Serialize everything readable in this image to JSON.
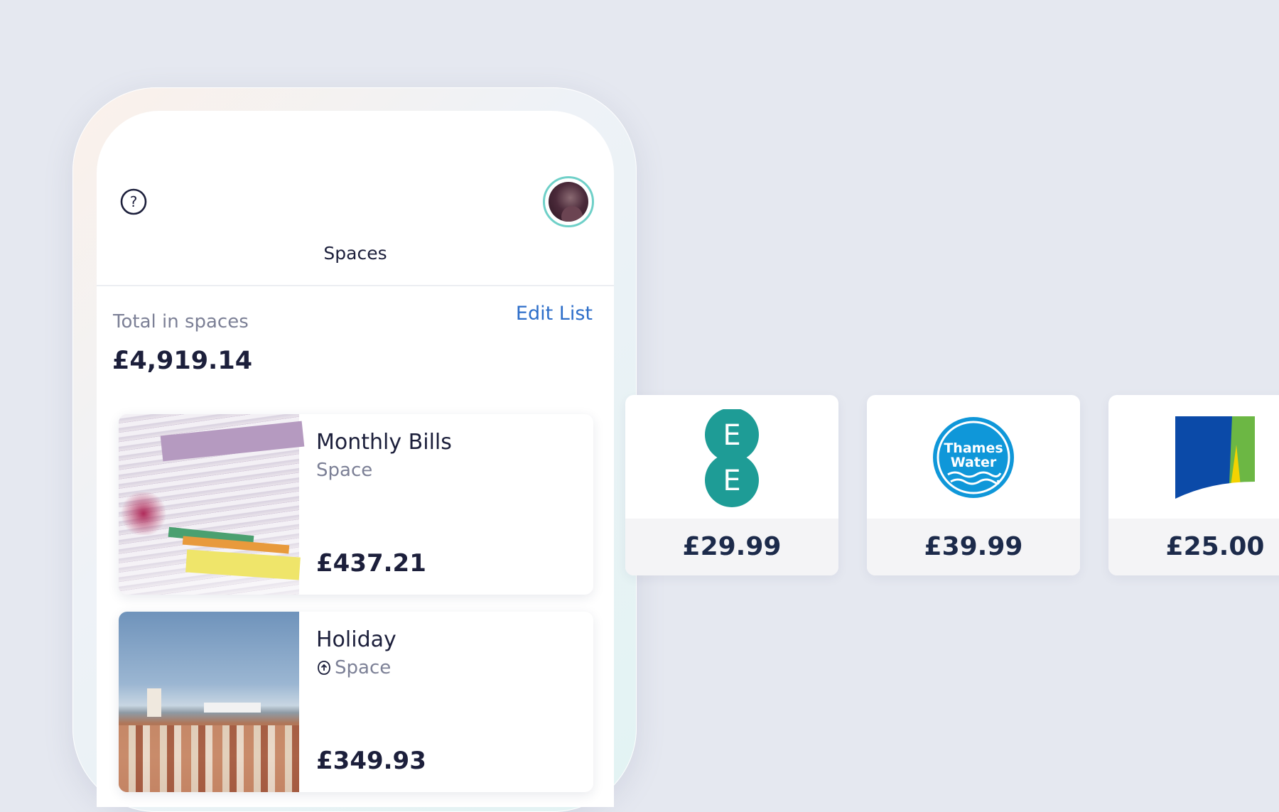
{
  "header": {
    "title": "Spaces",
    "help_icon": "question-circle-icon",
    "avatar_icon": "user-avatar"
  },
  "summary": {
    "label": "Total in spaces",
    "value": "£4,919.14",
    "edit_link": "Edit List"
  },
  "spaces": [
    {
      "title": "Monthly Bills",
      "subtitle": "Space",
      "amount": "£437.21",
      "image": "stack-of-bills-photo"
    },
    {
      "title": "Holiday",
      "subtitle": "Space",
      "amount": "£349.93",
      "image": "coastal-city-photo",
      "icon": "round-up-icon"
    }
  ],
  "billers": [
    {
      "logo": "ee-logo",
      "amount": "£29.99",
      "logo_color": "#1e9c96"
    },
    {
      "logo": "thames-water-logo",
      "logo_text_1": "Thames",
      "logo_text_2": "Water",
      "amount": "£39.99",
      "logo_color": "#0f97d9"
    },
    {
      "logo": "energy-company-logo",
      "amount": "£25.00",
      "logo_color": "#0b4aa8"
    }
  ],
  "colors": {
    "background": "#e5e8f0",
    "link": "#2d6ec9",
    "avatar_ring": "#6fd0c8"
  }
}
